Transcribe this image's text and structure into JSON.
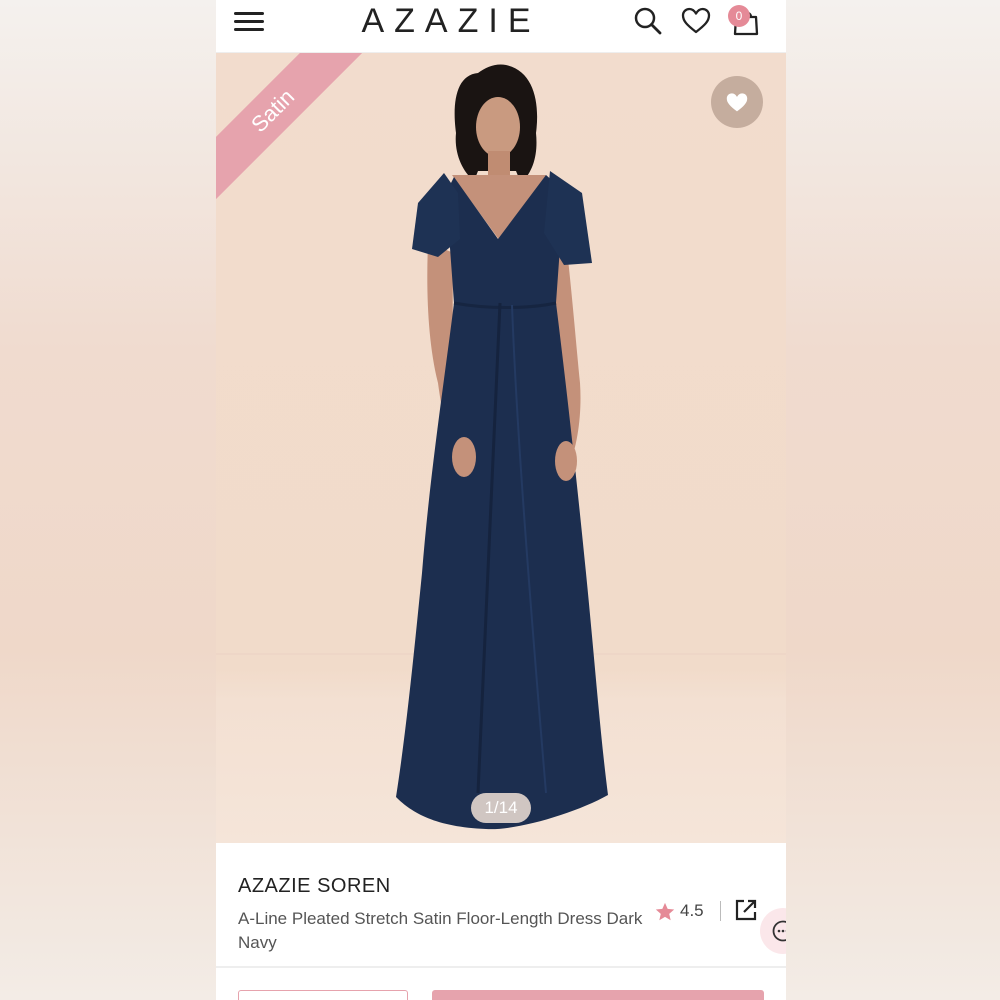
{
  "header": {
    "logo": "AZAZIE",
    "cart_count": "0"
  },
  "hero": {
    "ribbon_label": "Satin",
    "image_counter": "1/14",
    "dress_color": "#1c2e4f"
  },
  "product": {
    "brand_name": "AZAZIE SOREN",
    "description": "A-Line Pleated Stretch Satin Floor-Length Dress Dark Navy",
    "rating": "4.5"
  },
  "colors": {
    "accent_pink": "#e6a3ad",
    "badge_pink": "#e58a97",
    "navy": "#1c2e4f"
  },
  "icons": [
    "menu-icon",
    "search-icon",
    "heart-icon",
    "bag-icon",
    "star-icon",
    "share-icon",
    "chat-icon"
  ]
}
